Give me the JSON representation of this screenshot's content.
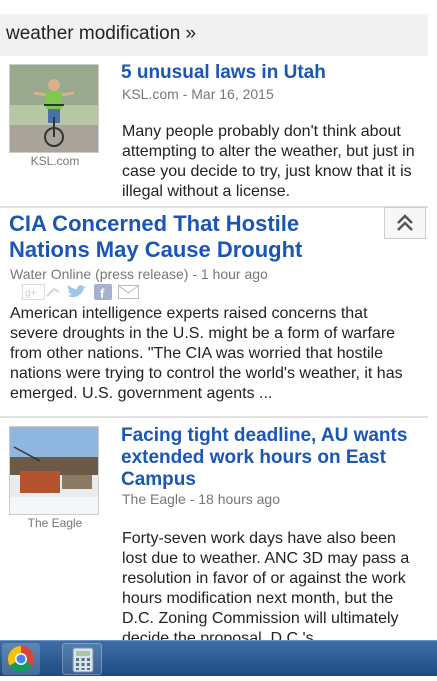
{
  "topic": {
    "label": "weather modification »"
  },
  "stories": [
    {
      "headline": "5 unusual laws in Utah",
      "source": "KSL.com - Mar 16, 2015",
      "thumb_source": "KSL.com",
      "snippet": "Many people probably don't think about attempting to alter the weather, but just in case you decide to try, just know that it is illegal without a license."
    },
    {
      "headline": "CIA Concerned That Hostile Nations May Cause Drought",
      "source": "Water Online (press release) - 1 hour ago",
      "snippet": "American intelligence experts raised concerns that severe droughts in the U.S. might be a form of warfare from other nations. \"The CIA was worried that hostile nations were trying to control the world's weather, it has emerged. U.S. government agents ..."
    },
    {
      "headline": "Facing tight deadline, AU wants extended work hours on East Campus",
      "source": "The Eagle - 18 hours ago",
      "thumb_source": "The Eagle",
      "snippet": "Forty-seven work days have also been lost due to weather. ANC 3D may pass a resolution in favor of or against the work hours modification next month, but the D.C. Zoning Commission will ultimately decide the proposal. D.C.'s ..."
    }
  ],
  "share_icons": [
    "google-plus-icon",
    "twitter-icon",
    "facebook-icon",
    "email-icon"
  ],
  "colors": {
    "headline": "#1a56b5",
    "source": "#777777",
    "taskbar": "#2b5a91"
  }
}
